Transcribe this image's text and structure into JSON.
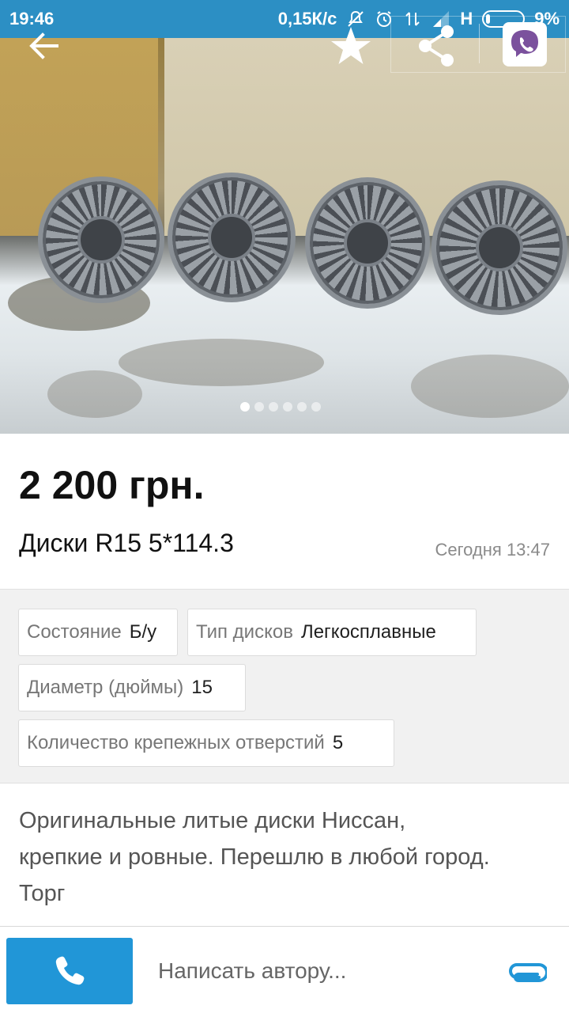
{
  "status_bar": {
    "time": "19:46",
    "network_speed": "0,15К/с",
    "network_type": "H",
    "battery": "9%"
  },
  "toolbar": {
    "back_icon": "arrow-left-icon",
    "favorite_icon": "star-icon",
    "share_icon": "share-icon",
    "viber_icon": "viber-icon"
  },
  "gallery": {
    "image_count": 6,
    "active_index": 0
  },
  "listing": {
    "price": "2 200 грн.",
    "title": "Диски R15 5*114.3",
    "date": "Сегодня 13:47"
  },
  "params": [
    {
      "key": "Состояние",
      "value": "Б/у"
    },
    {
      "key": "Тип дисков",
      "value": "Легкосплавные"
    },
    {
      "key": "Диаметр (дюймы)",
      "value": "15"
    },
    {
      "key": "Количество крепежных отверстий",
      "value": "5"
    }
  ],
  "description": {
    "lines": [
      "Оригинальные литые диски Ниссан,",
      "крепкие и ровные. Перешлю в любой город.",
      "Торг"
    ]
  },
  "bottom_bar": {
    "message_placeholder": "Написать автору...",
    "call_icon": "phone-icon",
    "attach_icon": "paperclip-icon"
  },
  "colors": {
    "status_bar": "#2c8fc4",
    "call_button": "#2196d7",
    "attach": "#2196d7"
  }
}
